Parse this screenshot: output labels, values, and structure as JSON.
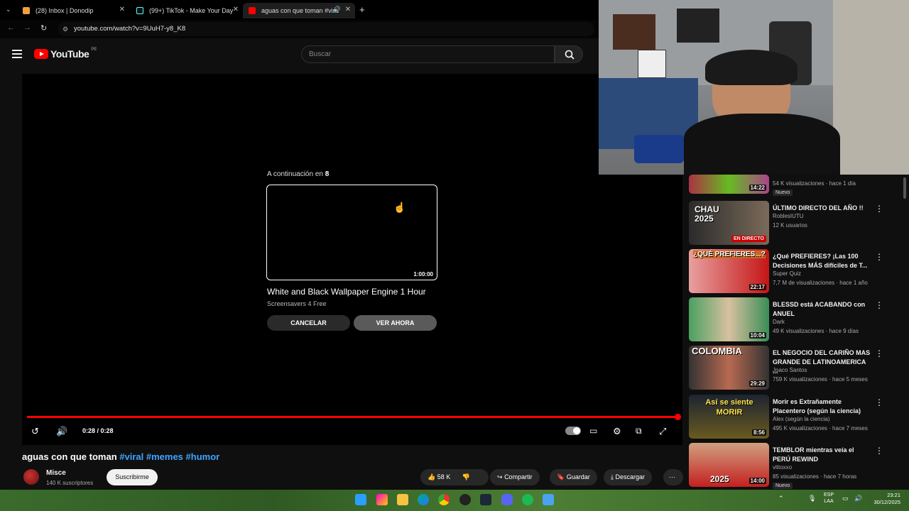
{
  "browser": {
    "tabs": [
      {
        "title": "(28) Inbox | Donodip",
        "color": "#f0a040"
      },
      {
        "title": "(99+) TikTok - Make Your Day",
        "color": "#111111"
      },
      {
        "title": "aguas con que toman #vira",
        "color": "#ff0000"
      }
    ],
    "new_tab": "+",
    "url": "youtube.com/watch?v=9UuH7-y8_K8"
  },
  "youtube": {
    "logo": "YouTube",
    "country": "PE",
    "search_placeholder": "Buscar"
  },
  "player": {
    "upnext_prefix": "A continuación en",
    "upnext_countdown": "8",
    "upnext_duration": "1:00:00",
    "upnext_title": "White and Black Wallpaper Engine 1 Hour",
    "upnext_channel": "Screensavers 4 Free",
    "cancel": "CANCELAR",
    "watch_now": "VER AHORA",
    "time": "0:28 / 0:28",
    "progress": 1.0
  },
  "video": {
    "title": "aguas con que toman",
    "hashtags": [
      "#viral",
      "#memes",
      "#humor"
    ],
    "channel": "Misce",
    "subscribers": "140 K suscriptores",
    "subscribe": "Suscribirme",
    "likes": "58 K",
    "share": "Compartir",
    "save": "Guardar",
    "download": "Descargar"
  },
  "recommendations": [
    {
      "title": "",
      "channel": "",
      "meta": "54 K visualizaciones · hace 1 día",
      "duration": "14:22",
      "badge": "Nuevo"
    },
    {
      "title": "ÚLTIMO DIRECTO DEL AÑO !!",
      "channel": "RoblesIUTU",
      "meta": "12 K usuarios",
      "duration": "EN DIRECTO",
      "thumb_text": "CHAU 2025"
    },
    {
      "title": "¿Qué PREFIERES? ¡Las 100 Decisiones MÁS difíciles de T...",
      "channel": "Super Quiz",
      "meta": "7,7 M de visualizaciones · hace 1 año",
      "duration": "22:17",
      "thumb_text": "¿QUÉ PREFIERES...?"
    },
    {
      "title": "BLESSD está ACABANDO con ANUEL",
      "channel": "Dark",
      "meta": "49 K visualizaciones · hace 9 días",
      "duration": "10:04"
    },
    {
      "title": "EL NEGOCIO DEL CARIÑO MAS GRANDE DE LATINOAMERICA ...",
      "channel": "Joaco Santos",
      "meta": "759 K visualizaciones · hace 5 meses",
      "duration": "29:29",
      "thumb_text": "COLOMBIA"
    },
    {
      "title": "Morir es Extrañamente Placentero (según la ciencia)",
      "channel": "Alex (según la ciencia)",
      "meta": "495 K visualizaciones · hace 7 meses",
      "duration": "8:56",
      "thumb_text": "Así se siente MORIR"
    },
    {
      "title": "TEMBLOR mientras veía el PERÚ REWIND",
      "channel": "vittoxxo",
      "meta": "85 visualizaciones · hace 7 horas",
      "duration": "14:00",
      "badge": "Nuevo",
      "thumb_text": "2025"
    }
  ],
  "taskbar": {
    "lang_top": "ESP",
    "lang_bottom": "LAA",
    "time": "23:21",
    "date": "30/12/2025"
  }
}
